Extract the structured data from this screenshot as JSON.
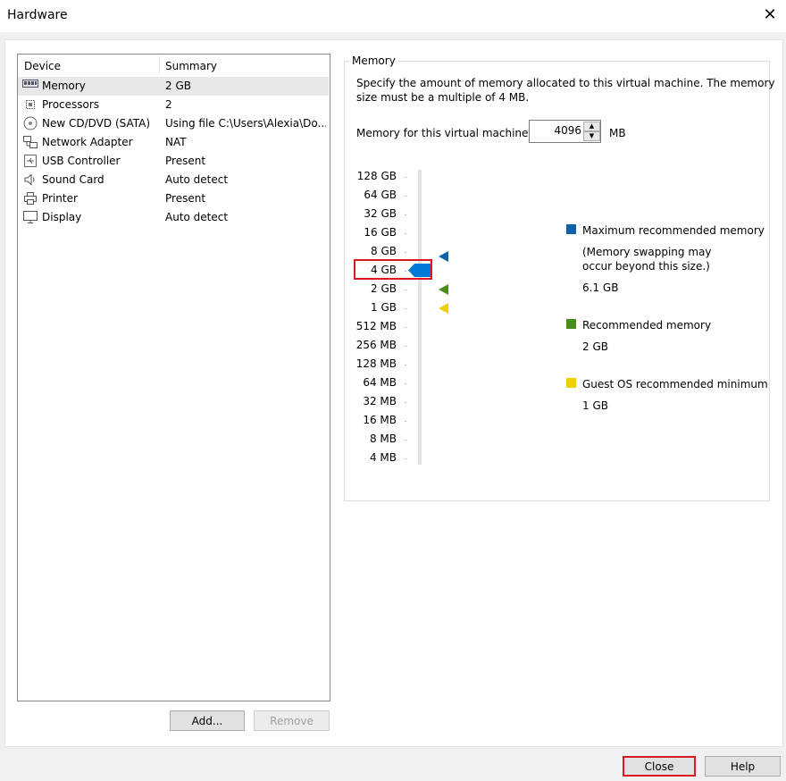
{
  "window": {
    "title": "Hardware",
    "close_glyph": "✕"
  },
  "device_list": {
    "headers": {
      "device": "Device",
      "summary": "Summary"
    },
    "items": [
      {
        "name": "Memory",
        "summary": "2 GB",
        "icon": "memory-icon",
        "selected": true
      },
      {
        "name": "Processors",
        "summary": "2",
        "icon": "processor-icon"
      },
      {
        "name": "New CD/DVD (SATA)",
        "summary": "Using file C:\\Users\\Alexia\\Do...",
        "icon": "cd-dvd-icon"
      },
      {
        "name": "Network Adapter",
        "summary": "NAT",
        "icon": "network-adapter-icon"
      },
      {
        "name": "USB Controller",
        "summary": "Present",
        "icon": "usb-icon"
      },
      {
        "name": "Sound Card",
        "summary": "Auto detect",
        "icon": "speaker-icon"
      },
      {
        "name": "Printer",
        "summary": "Present",
        "icon": "printer-icon"
      },
      {
        "name": "Display",
        "summary": "Auto detect",
        "icon": "monitor-icon"
      }
    ]
  },
  "buttons": {
    "add": "Add...",
    "remove": "Remove",
    "close": "Close",
    "help": "Help"
  },
  "memory": {
    "group_title": "Memory",
    "description_line1": "Specify the amount of memory allocated to this virtual machine. The memory",
    "description_line2": "size must be a multiple of 4 MB.",
    "field_label": "Memory for this virtual machine:",
    "value": "4096",
    "unit": "MB",
    "scale": [
      "128 GB",
      "64 GB",
      "32 GB",
      "16 GB",
      "8 GB",
      "4 GB",
      "2 GB",
      "1 GB",
      "512 MB",
      "256 MB",
      "128 MB",
      "64 MB",
      "32 MB",
      "16 MB",
      "8 MB",
      "4 MB"
    ],
    "selected_scale": "4 GB",
    "legend": {
      "max": {
        "label": "Maximum recommended memory",
        "note_line1": "(Memory swapping may",
        "note_line2": "occur beyond this size.)",
        "value": "6.1 GB",
        "color": "#1060a8"
      },
      "recommended": {
        "label": "Recommended memory",
        "value": "2 GB",
        "color": "#4a8c1c"
      },
      "guest_min": {
        "label": "Guest OS recommended minimum",
        "value": "1 GB",
        "color": "#f0d000"
      }
    },
    "slider_color": "#0078d7",
    "highlight_color": "#d9191f"
  }
}
